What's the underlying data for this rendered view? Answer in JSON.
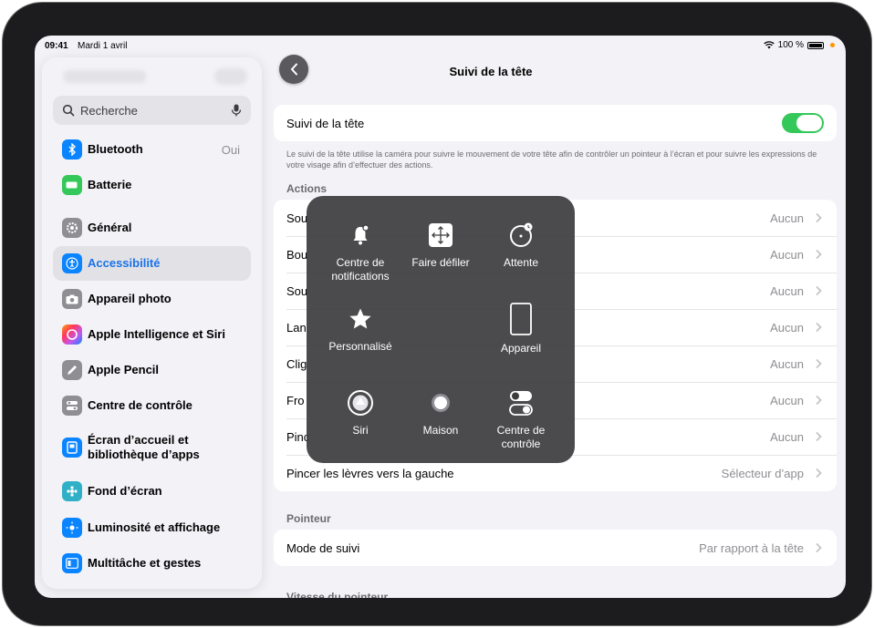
{
  "status": {
    "time": "09:41",
    "date": "Mardi 1 avril",
    "battery": "100 %"
  },
  "sidebar": {
    "search_placeholder": "Recherche",
    "items": [
      {
        "label": "Bluetooth",
        "value": "Oui",
        "icon": "bluetooth-icon",
        "color": "#0a84ff"
      },
      {
        "label": "Batterie",
        "icon": "battery-icon",
        "color": "#34c759"
      },
      {
        "label": "Général",
        "icon": "gear-icon",
        "color": "#8e8e93"
      },
      {
        "label": "Accessibilité",
        "icon": "accessibility-icon",
        "color": "#0a84ff"
      },
      {
        "label": "Appareil photo",
        "icon": "camera-icon",
        "color": "#8e8e93"
      },
      {
        "label": "Apple Intelligence et Siri",
        "icon": "apple-intelligence-icon",
        "color": "#bf5af2"
      },
      {
        "label": "Apple Pencil",
        "icon": "pencil-icon",
        "color": "#8e8e93"
      },
      {
        "label": "Centre de contrôle",
        "icon": "control-center-icon",
        "color": "#8e8e93"
      },
      {
        "label": "Écran d’accueil et bibliothèque d’apps",
        "icon": "home-screen-icon",
        "color": "#0a84ff"
      },
      {
        "label": "Fond d’écran",
        "icon": "wallpaper-icon",
        "color": "#30b0c7"
      },
      {
        "label": "Luminosité et affichage",
        "icon": "brightness-icon",
        "color": "#0a84ff"
      },
      {
        "label": "Multitâche et gestes",
        "icon": "multitasking-icon",
        "color": "#0a84ff"
      }
    ]
  },
  "main": {
    "title": "Suivi de la tête",
    "toggle_row": {
      "label": "Suivi de la tête",
      "on": true
    },
    "footnote": "Le suivi de la tête utilise la caméra pour suivre le mouvement de votre tête afin de contrôler un pointeur à l’écran et pour suivre les expressions de votre visage afin d’effectuer des actions.",
    "actions_header": "Actions",
    "actions": [
      {
        "label": "Sou",
        "value": "Aucun"
      },
      {
        "label": "Bou",
        "value": "Aucun"
      },
      {
        "label": "Sou",
        "value": "Aucun"
      },
      {
        "label": "Lan",
        "value": "Aucun"
      },
      {
        "label": "Clig",
        "value": "Aucun"
      },
      {
        "label": "Fro",
        "value": "Aucun"
      },
      {
        "label": "Pinc",
        "value": "Aucun"
      },
      {
        "label": "Pincer les lèvres vers la gauche",
        "value": "Sélecteur d’app"
      }
    ],
    "pointer_header": "Pointeur",
    "pointer_row": {
      "label": "Mode de suivi",
      "value": "Par rapport à la tête"
    },
    "next_header": "Vitesse du pointeur"
  },
  "overlay": {
    "items": [
      {
        "label": "Centre de notifications",
        "icon": "notification-bell-icon"
      },
      {
        "label": "Faire défiler",
        "icon": "scroll-arrows-icon"
      },
      {
        "label": "Attente",
        "icon": "dwell-timer-icon"
      },
      {
        "label": "Personnalisé",
        "icon": "star-icon"
      },
      {
        "label": "Appareil",
        "icon": "device-icon"
      },
      {
        "label": "Siri",
        "icon": "siri-icon"
      },
      {
        "label": "Maison",
        "icon": "home-button-icon"
      },
      {
        "label": "Centre de contrôle",
        "icon": "control-center-toggles-icon"
      }
    ]
  }
}
